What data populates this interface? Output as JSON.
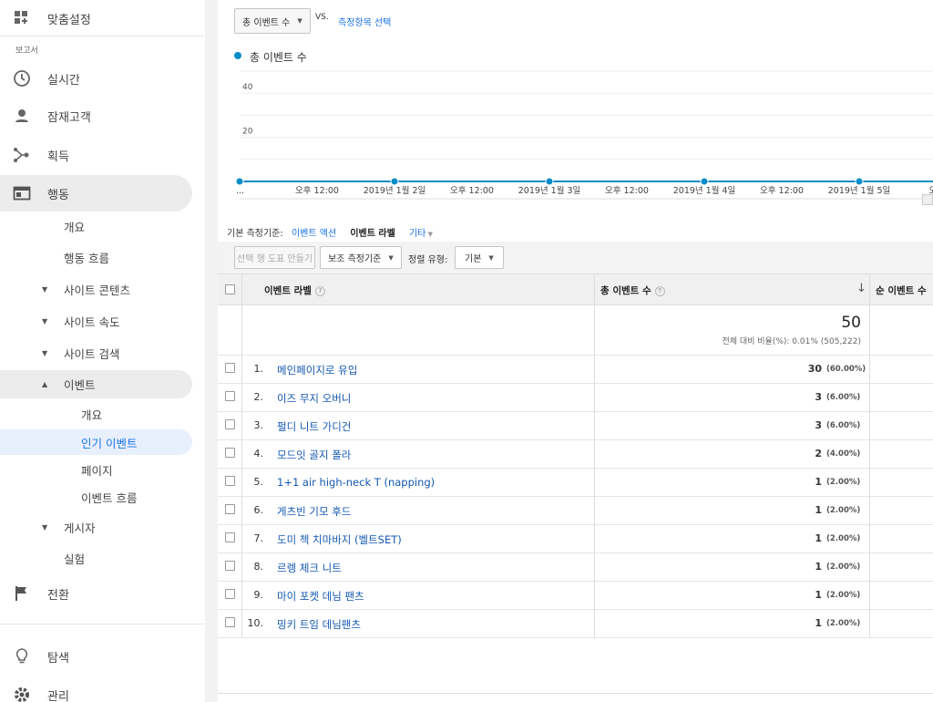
{
  "sidebar": {
    "custom": "맞춤설정",
    "reports_section": "보고서",
    "realtime": "실시간",
    "audience": "잠재고객",
    "acquisition": "획득",
    "behavior": "행동",
    "behavior_overview": "개요",
    "behavior_flow": "행동 흐름",
    "site_content": "사이트 콘텐츠",
    "site_speed": "사이트 속도",
    "site_search": "사이트 검색",
    "events": "이벤트",
    "events_overview": "개요",
    "top_events": "인기 이벤트",
    "pages": "페이지",
    "events_flow": "이벤트 흐름",
    "publisher": "게시자",
    "experiments": "실험",
    "conversions": "전환",
    "discover": "탐색",
    "admin": "관리"
  },
  "toolbar": {
    "metric_select": "총 이벤트 수",
    "vs": "VS.",
    "select_metric_link": "측정항목 선택"
  },
  "chart_data": {
    "type": "line",
    "series": [
      {
        "name": "총 이벤트 수",
        "color": "#058dc7",
        "values": [
          0,
          0,
          0,
          0,
          0,
          0,
          0,
          0,
          0,
          0
        ]
      }
    ],
    "x": [
      "...",
      "오후 12:00",
      "2019년 1월 2일",
      "오후 12:00",
      "2019년 1월 3일",
      "오후 12:00",
      "2019년 1월 4일",
      "오후 12:00",
      "2019년 1월 5일",
      "오후"
    ],
    "y_ticks": [
      40,
      20
    ],
    "ylim": [
      0,
      50
    ]
  },
  "dimension": {
    "label": "기본 측정기준:",
    "action": "이벤트 액션",
    "event_label": "이벤트 라벨",
    "other": "기타"
  },
  "controls": {
    "plot_rows": "선택 행 도표 만들기",
    "secondary": "보조 측정기준",
    "sort_label": "정렬 유형:",
    "sort_value": "기본"
  },
  "table": {
    "col_label": "이벤트 라벨",
    "col_total": "총 이벤트 수",
    "col_unique": "순 이벤트 수",
    "total_value": "50",
    "total_note": "전체 대비 비율(%): 0.01% (505,222)",
    "rows": [
      {
        "num": "1.",
        "label": "메인페이지로 유입",
        "value": "30",
        "pct": "(60.00%)"
      },
      {
        "num": "2.",
        "label": "이즈 무지 오버니",
        "value": "3",
        "pct": "(6.00%)"
      },
      {
        "num": "3.",
        "label": "펄디 니트 가디건",
        "value": "3",
        "pct": "(6.00%)"
      },
      {
        "num": "4.",
        "label": "모드잇 골지 폴라",
        "value": "2",
        "pct": "(4.00%)"
      },
      {
        "num": "5.",
        "label": "1+1 air high-neck T (napping)",
        "value": "1",
        "pct": "(2.00%)"
      },
      {
        "num": "6.",
        "label": "게츠빈 기모 후드",
        "value": "1",
        "pct": "(2.00%)"
      },
      {
        "num": "7.",
        "label": "도미 첵 치마바지 (벨트SET)",
        "value": "1",
        "pct": "(2.00%)"
      },
      {
        "num": "8.",
        "label": "르렝 체크 니트",
        "value": "1",
        "pct": "(2.00%)"
      },
      {
        "num": "9.",
        "label": "마이 포켓 데님 팬츠",
        "value": "1",
        "pct": "(2.00%)"
      },
      {
        "num": "10.",
        "label": "밍키 트임 데님팬츠",
        "value": "1",
        "pct": "(2.00%)"
      }
    ]
  }
}
